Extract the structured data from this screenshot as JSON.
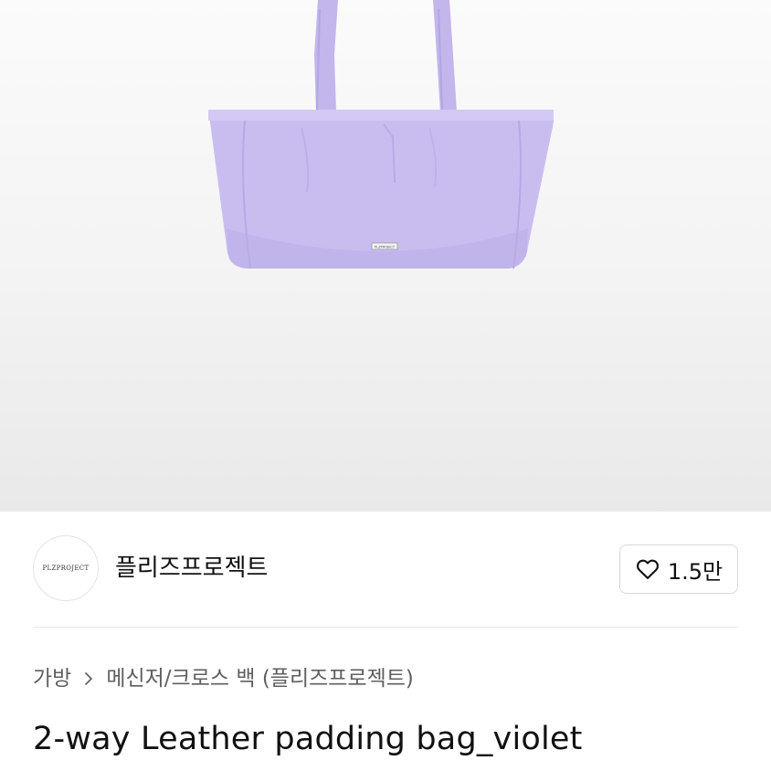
{
  "product_image": {
    "alt": "2-way Leather padding bag_violet",
    "bag_color": "#c9bdf0",
    "label_text": "PLZPROJECT"
  },
  "brand": {
    "logo_text": "PLZPROJECT",
    "name": "플리즈프로젝트"
  },
  "like": {
    "icon": "heart-icon",
    "count": "1.5만"
  },
  "breadcrumb": {
    "items": [
      "가방",
      "메신저/크로스 백 (플리즈프로젝트)"
    ],
    "separator_icon": "chevron-right-icon"
  },
  "product": {
    "title": "2-way Leather padding bag_violet"
  }
}
